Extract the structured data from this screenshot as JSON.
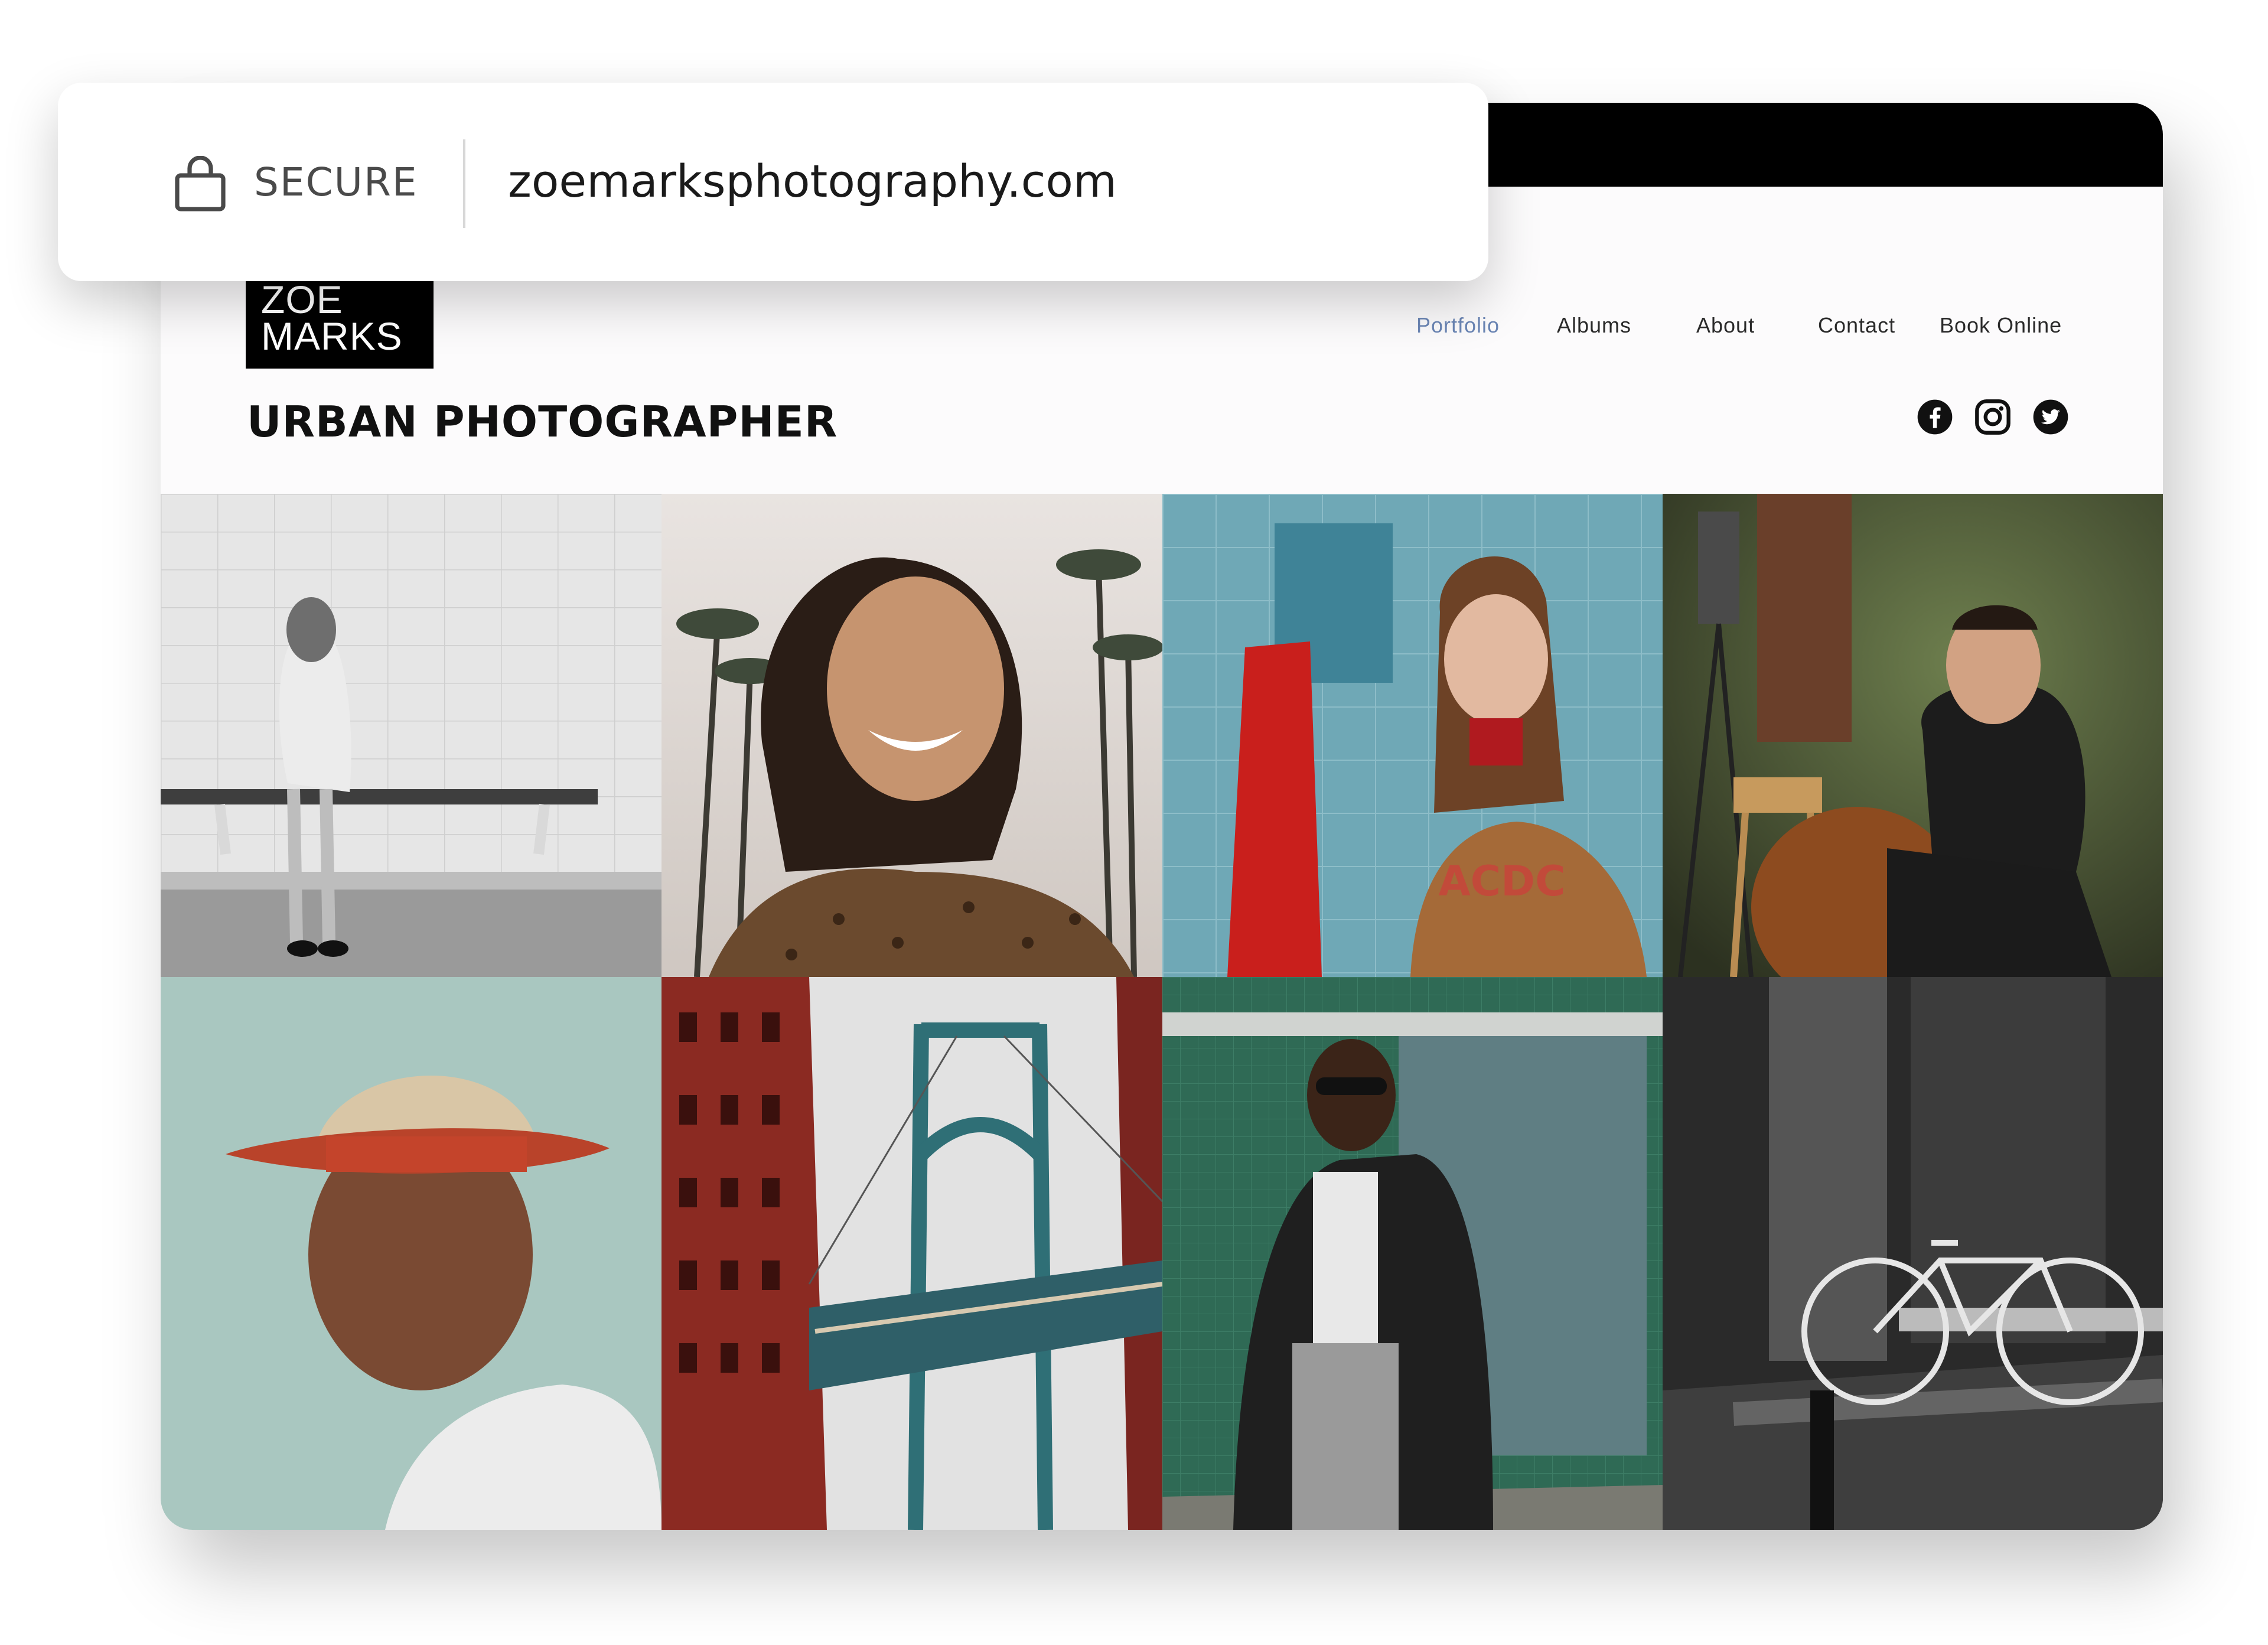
{
  "browser": {
    "secure_label": "SECURE",
    "url": "zoemarksphotography.com"
  },
  "site": {
    "logo": {
      "line1": "ZOE",
      "line2": "MARKS"
    },
    "tagline": "URBAN PHOTOGRAPHER",
    "nav": [
      {
        "label": "Portfolio",
        "active": true
      },
      {
        "label": "Albums",
        "active": false
      },
      {
        "label": "About",
        "active": false
      },
      {
        "label": "Contact",
        "active": false
      },
      {
        "label": "Book Online",
        "active": false
      }
    ],
    "social": [
      "facebook-icon",
      "instagram-icon",
      "twitter-icon"
    ]
  },
  "gallery": {
    "photos": [
      "woman-on-bench-photo",
      "smiling-woman-palms-photo",
      "woman-tiled-wall-photo",
      "man-bean-bag-photo",
      "man-red-hat-photo",
      "manhattan-bridge-photo",
      "man-leather-jacket-photo",
      "bicycle-storefront-photo"
    ]
  },
  "colors": {
    "accent": "#6b86b5",
    "topbar": "#000000",
    "text": "#111111"
  }
}
